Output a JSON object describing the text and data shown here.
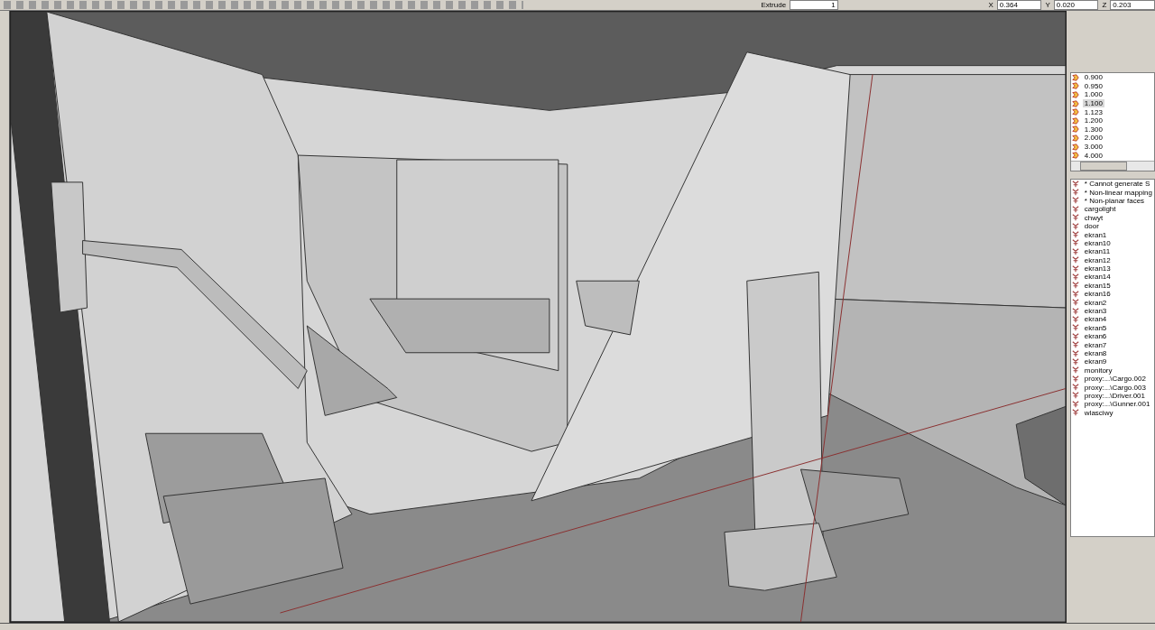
{
  "toolbar": {
    "extrude_label": "Extrude",
    "extrude_value": "1",
    "coordinates": [
      {
        "axis": "X",
        "value": "0.364"
      },
      {
        "axis": "Y",
        "value": "0.020"
      },
      {
        "axis": "Z",
        "value": "0.203"
      }
    ]
  },
  "lods": [
    {
      "label": "0.900",
      "selected": false
    },
    {
      "label": "0.950",
      "selected": false
    },
    {
      "label": "1.000",
      "selected": false
    },
    {
      "label": "1.100",
      "selected": true
    },
    {
      "label": "1.123",
      "selected": false
    },
    {
      "label": "1.200",
      "selected": false
    },
    {
      "label": "1.300",
      "selected": false
    },
    {
      "label": "2.000",
      "selected": false
    },
    {
      "label": "3.000",
      "selected": false
    },
    {
      "label": "4.000",
      "selected": false
    }
  ],
  "selections": [
    "* Cannot generate S",
    "* Non-linear mapping",
    "* Non-planar faces",
    "cargolight",
    "chwyt",
    "door",
    "ekran1",
    "ekran10",
    "ekran11",
    "ekran12",
    "ekran13",
    "ekran14",
    "ekran15",
    "ekran16",
    "ekran2",
    "ekran3",
    "ekran4",
    "ekran5",
    "ekran6",
    "ekran7",
    "ekran8",
    "ekran9",
    "monitory",
    "proxy:...\\Cargo.002",
    "proxy:...\\Cargo.003",
    "proxy:...\\Driver.001",
    "proxy:...\\Gunner.001",
    "wlasciwy"
  ]
}
